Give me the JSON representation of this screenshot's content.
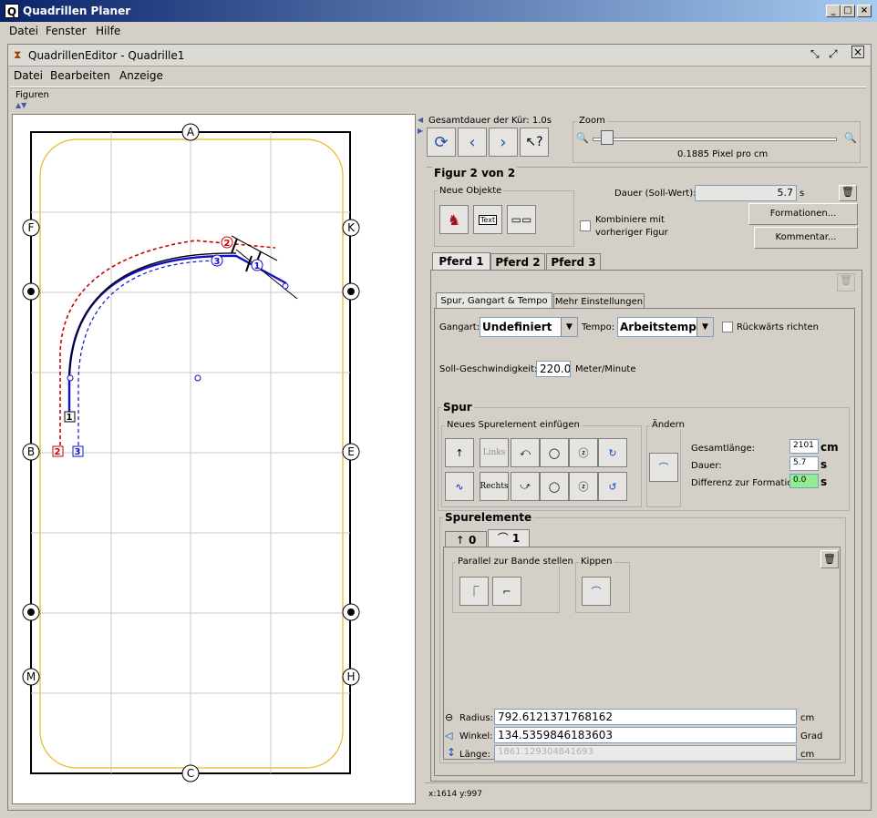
{
  "app": {
    "title": "Quadrillen Planer",
    "menu": [
      "Datei",
      "Fenster",
      "Hilfe"
    ]
  },
  "editor": {
    "title": "QuadrillenEditor - Quadrille1",
    "menu": [
      "Datei",
      "Bearbeiten",
      "Anzeige"
    ],
    "section": "Figuren"
  },
  "arena": {
    "letters": {
      "top": "A",
      "bottom": "C",
      "left_top": "F",
      "left_mid": "B",
      "left_bottom": "M",
      "right_top": "K",
      "right_mid": "E",
      "right_bottom": "H"
    },
    "markers": {
      "m1": "1",
      "m2": "2",
      "m3": "3",
      "n1": "1",
      "n2": "2",
      "n3": "3"
    }
  },
  "top": {
    "duration_label": "Gesamtdauer der Kür: 1.0s",
    "zoom_label": "Zoom",
    "zoom_value": 0.05,
    "zoom_text": "0.1885 Pixel pro cm"
  },
  "figure": {
    "title": "Figur 2 von 2",
    "neue_objekte": "Neue Objekte",
    "text_icon": "Text",
    "dauer_label": "Dauer (Soll-Wert):",
    "dauer_value": "5.7",
    "dauer_unit": "s",
    "kombiniere": "Kombiniere mit vorheriger Figur",
    "formationen": "Formationen...",
    "kommentar": "Kommentar..."
  },
  "pferd_tabs": [
    "Pferd 1",
    "Pferd 2",
    "Pferd 3"
  ],
  "sub_tabs": [
    "Spur, Gangart & Tempo",
    "Mehr Einstellungen"
  ],
  "gang": {
    "gangart_label": "Gangart:",
    "gangart_value": "Undefiniert",
    "tempo_label": "Tempo:",
    "tempo_value": "Arbeitstempo",
    "rueck": "Rückwärts richten",
    "soll_label": "Soll-Geschwindigkeit:",
    "soll_value": "220.0",
    "soll_unit": "Meter/Minute"
  },
  "spur": {
    "title": "Spur",
    "neues": "Neues Spurelement einfügen",
    "links": "Links",
    "rechts": "Rechts",
    "aendern": "Ändern",
    "gesamt_label": "Gesamtlänge:",
    "gesamt_value": "2101",
    "gesamt_unit": "cm",
    "dauer_label": "Dauer:",
    "dauer_value": "5.7",
    "dauer_unit": "s",
    "diff_label": "Differenz zur Formation:",
    "diff_value": "0.0",
    "diff_unit": "s"
  },
  "spurelemente": {
    "title": "Spurelemente",
    "tabs": [
      "0",
      "1"
    ],
    "parallel": "Parallel zur Bande stellen",
    "kippen": "Kippen",
    "radius_label": "Radius:",
    "radius_value": "792.6121371768162",
    "radius_unit": "cm",
    "winkel_label": "Winkel:",
    "winkel_value": "134.5359846183603",
    "winkel_unit": "Grad",
    "laenge_label": "Länge:",
    "laenge_value": "1861.129304841693",
    "laenge_unit": "cm"
  },
  "status": "x:1614 y:997",
  "colors": {
    "red": "#cc0000",
    "blue": "#1010cc",
    "black": "#000000",
    "arena_inner": "#e8b820",
    "grid": "#c8c8c8"
  }
}
